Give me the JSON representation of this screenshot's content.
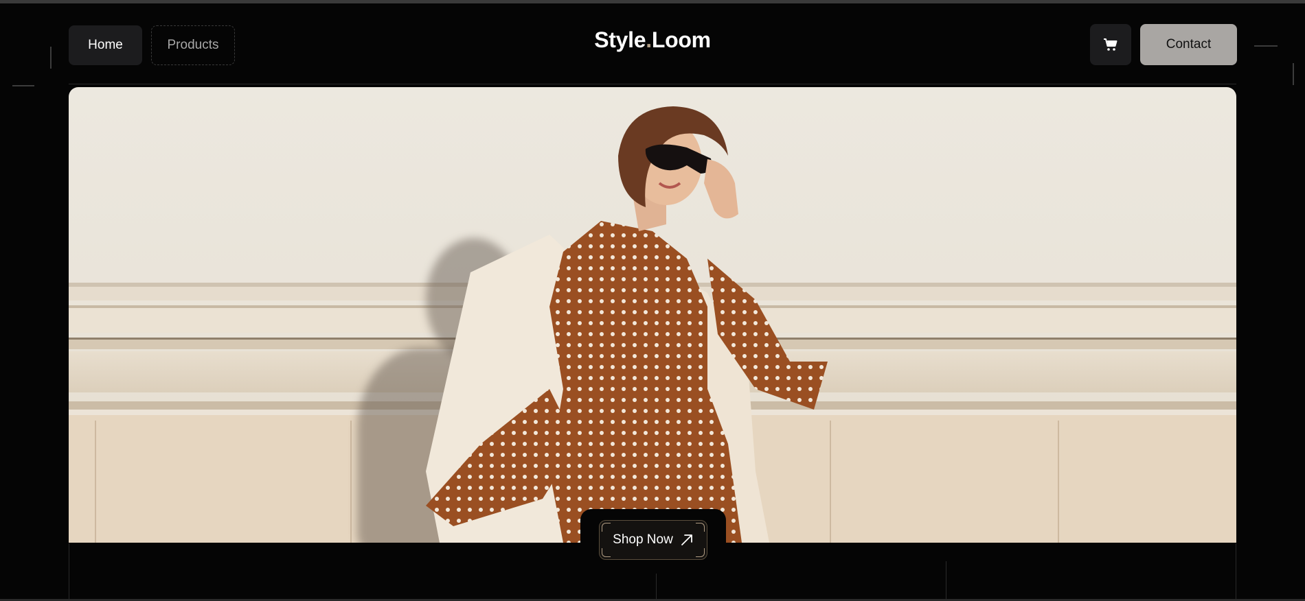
{
  "header": {
    "home_label": "Home",
    "products_label": "Products",
    "logo_part1": "Style",
    "logo_dot": ".",
    "logo_part2": "Loom",
    "cart_icon": "shopping-cart-icon",
    "contact_label": "Contact"
  },
  "hero": {
    "image_description_hidden": "",
    "cta_label": "Shop Now",
    "cta_icon": "arrow-up-right-icon"
  },
  "colors": {
    "background": "#050505",
    "accent": "#b29e84",
    "contact_bg": "#a9a6a3",
    "nav_bg": "#1c1c1e"
  }
}
